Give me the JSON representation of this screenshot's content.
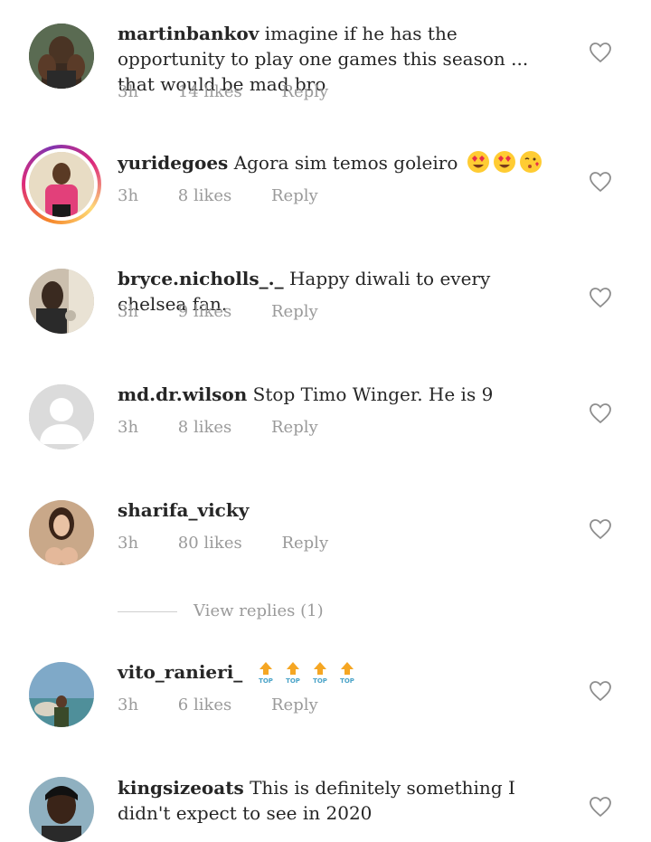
{
  "comments": [
    {
      "username": "martinbankov",
      "text": "imagine if he has the opportunity to play one games this season ... that would be mad bro",
      "time": "3h",
      "likes": "14 likes",
      "reply": "Reply"
    },
    {
      "username": "yuridegoes",
      "text": "Agora sim temos goleiro",
      "emojis": [
        "heart-eyes-emoji",
        "heart-eyes-emoji",
        "kissing-heart-emoji"
      ],
      "time": "3h",
      "likes": "8 likes",
      "reply": "Reply",
      "has_story": true
    },
    {
      "username": "bryce.nicholls_._",
      "text": "Happy diwali to every chelsea fan.",
      "time": "3h",
      "likes": "9 likes",
      "reply": "Reply"
    },
    {
      "username": "md.dr.wilson",
      "text": "Stop Timo Winger. He is 9",
      "time": "3h",
      "likes": "8 likes",
      "reply": "Reply"
    },
    {
      "username": "sharifa_vicky",
      "text": "",
      "time": "3h",
      "likes": "80 likes",
      "reply": "Reply"
    },
    {
      "username": "vito_ranieri_",
      "text": "",
      "emojis": [
        "top-emoji",
        "top-emoji",
        "top-emoji",
        "top-emoji"
      ],
      "time": "3h",
      "likes": "6 likes",
      "reply": "Reply"
    },
    {
      "username": "kingsizeoats",
      "text": "This is definitely something I didn't expect to see in 2020",
      "time": "",
      "likes": "",
      "reply": ""
    }
  ],
  "view_replies": "View replies (1)",
  "colors": {
    "text": "#262626",
    "meta": "#9a9a9a",
    "heart_outline": "#8e8e8e",
    "story_ring": [
      "#f58529",
      "#dd2a7b",
      "#8134af"
    ]
  }
}
